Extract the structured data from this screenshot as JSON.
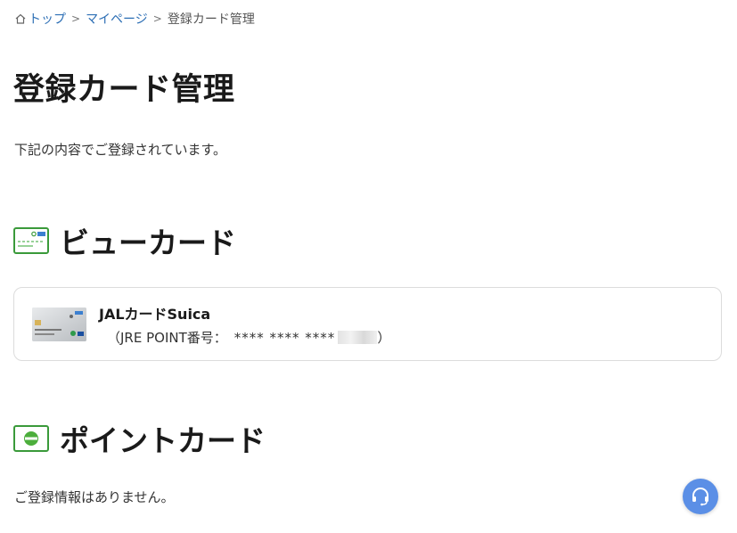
{
  "breadcrumb": {
    "items": [
      "トップ",
      "マイページ",
      "登録カード管理"
    ],
    "separator": ">"
  },
  "page": {
    "title": "登録カード管理",
    "intro": "下記の内容でご登録されています。"
  },
  "view_card_section": {
    "heading": "ビューカード",
    "card": {
      "name": "JALカードSuica",
      "number_label": "（JRE POINT番号：",
      "number_masked": "**** **** ****",
      "number_close": "）"
    }
  },
  "point_card_section": {
    "heading": "ポイントカード",
    "empty_message": "ご登録情報はありません。"
  },
  "icons": {
    "home": "home-icon",
    "view_card": "credit-card-icon",
    "point_card": "point-card-icon",
    "support": "headset-icon"
  },
  "colors": {
    "link": "#2d6fb5",
    "brand_green": "#3a9a3a",
    "support_button": "#5b8fe6"
  }
}
